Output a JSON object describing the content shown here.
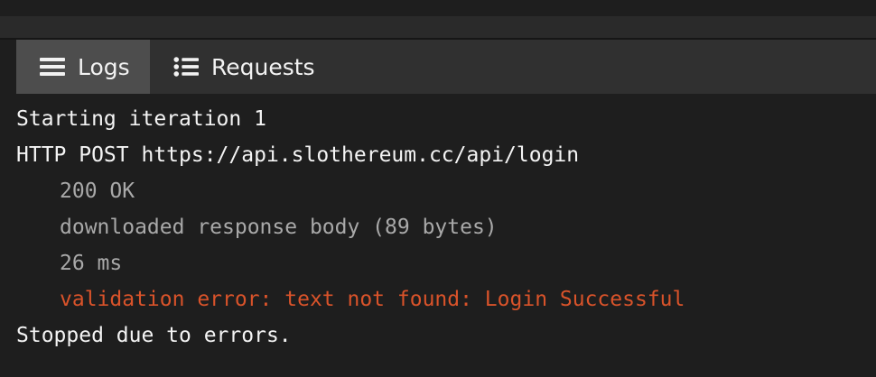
{
  "tabs": [
    {
      "label": "Logs",
      "icon": "list-lines-icon",
      "active": true
    },
    {
      "label": "Requests",
      "icon": "bulleted-list-icon",
      "active": false
    }
  ],
  "log_lines": {
    "l1": "Starting iteration 1",
    "l2": "HTTP POST https://api.slothereum.cc/api/login",
    "l3": "200 OK",
    "l4": "downloaded response body (89 bytes)",
    "l5": "26 ms",
    "l6": "validation error: text not found: Login Successful",
    "l7": "Stopped due to errors."
  },
  "colors": {
    "background": "#1e1e1e",
    "tabbar": "#303030",
    "active_tab": "#4d4d4d",
    "text": "#f4f4f4",
    "muted_text": "#a9a9a9",
    "error_text": "#d9532a"
  }
}
